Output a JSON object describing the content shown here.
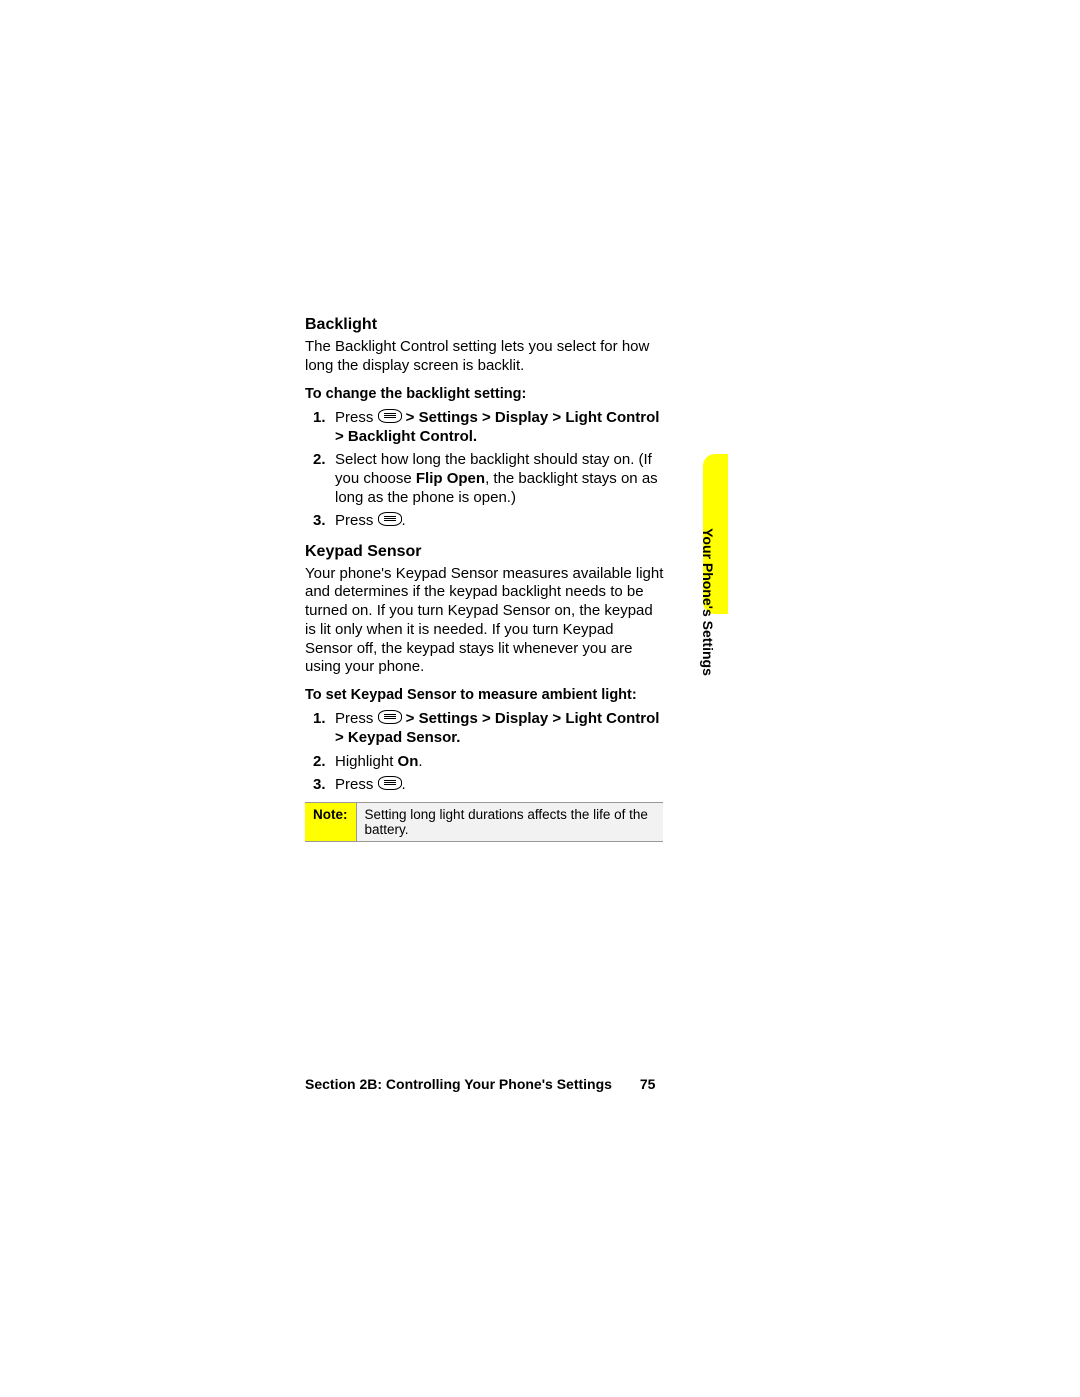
{
  "sideTab": "Your Phone's Settings",
  "sections": {
    "backlight": {
      "heading": "Backlight",
      "intro": "The Backlight Control setting lets you select for how long the display screen is backlit.",
      "lead": "To change the backlight setting:",
      "step1_prefix": "Press ",
      "step1_path": " > Settings > Display > Light Control > Backlight Control.",
      "step2_a": "Select how long the backlight should stay on. (If you choose ",
      "step2_b": "Flip Open",
      "step2_c": ", the backlight stays on as long as the phone is open.)",
      "step3_prefix": "Press ",
      "step3_suffix": "."
    },
    "keypad": {
      "heading": "Keypad Sensor",
      "intro": "Your phone's Keypad Sensor measures available light and determines if the keypad backlight needs to be turned on. If you turn Keypad Sensor on, the keypad is lit only when it is needed. If you turn Keypad Sensor off, the keypad stays lit whenever you are using your phone.",
      "lead": "To set Keypad Sensor to measure ambient light:",
      "step1_prefix": "Press ",
      "step1_path": " > Settings > Display > Light Control > Keypad Sensor.",
      "step2_a": "Highlight ",
      "step2_b": "On",
      "step2_c": ".",
      "step3_prefix": "Press ",
      "step3_suffix": "."
    }
  },
  "note": {
    "label": "Note:",
    "text": "Setting long light durations affects the life of the battery."
  },
  "footer": {
    "section": "Section 2B: Controlling Your Phone's Settings",
    "page": "75"
  }
}
